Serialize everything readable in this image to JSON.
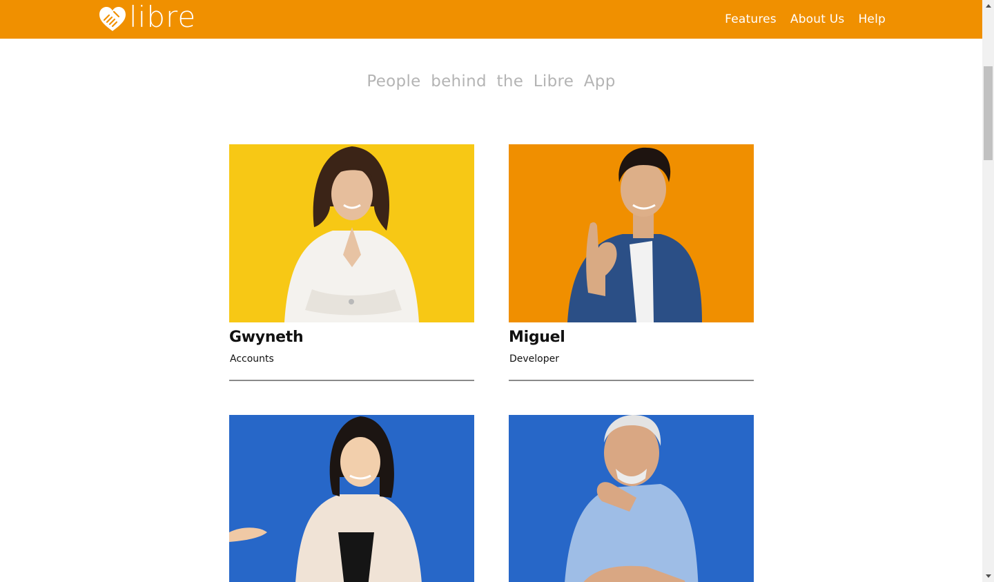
{
  "header": {
    "brand": "libre",
    "nav": [
      "Features",
      "About Us",
      "Help"
    ]
  },
  "main": {
    "heading": "People behind the Libre App",
    "team": [
      {
        "name": "Gwyneth",
        "role": "Accounts",
        "photo_bg": "#f7c815"
      },
      {
        "name": "Miguel",
        "role": "Developer",
        "photo_bg": "#f08f00"
      },
      {
        "name": "",
        "role": "",
        "photo_bg": "#2767c8"
      },
      {
        "name": "",
        "role": "",
        "photo_bg": "#2767c8"
      }
    ]
  },
  "colors": {
    "brand": "#f09000",
    "heading_text": "#b4b4b4",
    "divider": "#8a8a8a"
  }
}
